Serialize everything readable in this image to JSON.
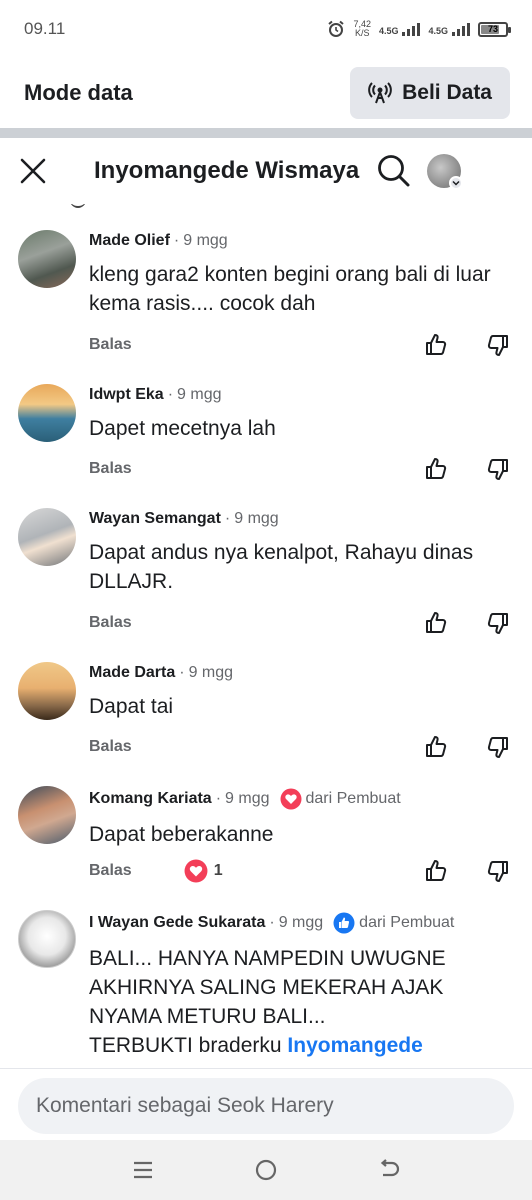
{
  "status_bar": {
    "time": "09.11",
    "net_speed": "7,42",
    "net_unit": "K/S",
    "signal1": "4.5G",
    "signal2": "4.5G",
    "battery": "73",
    "icons": [
      "alarm-icon",
      "signal-icon",
      "battery-icon"
    ]
  },
  "data_bar": {
    "title": "Mode data",
    "buy_label": "Beli Data"
  },
  "header": {
    "title": "Inyomangede Wismaya"
  },
  "comments": [
    {
      "name": "Made Olief",
      "time": "9 mgg",
      "text": "kleng gara2 konten begini orang bali di luar kema rasis.... cocok dah",
      "reply": "Balas"
    },
    {
      "name": "Idwpt Eka",
      "time": "9 mgg",
      "text": "Dapet mecetnya lah",
      "reply": "Balas"
    },
    {
      "name": "Wayan Semangat",
      "time": "9 mgg",
      "text": "Dapat andus nya kenalpot, Rahayu dinas DLLAJR.",
      "reply": "Balas"
    },
    {
      "name": "Made Darta",
      "time": "9 mgg",
      "text": "Dapat tai",
      "reply": "Balas"
    },
    {
      "name": "Komang Kariata",
      "time": "9 mgg",
      "badge": "dari Pembuat",
      "text": "Dapat beberakanne",
      "reply": "Balas",
      "reaction_count": "1"
    },
    {
      "name": "I Wayan Gede Sukarata",
      "time": "9 mgg",
      "badge": "dari Pembuat",
      "text": "BALI... HANYA NAMPEDIN UWUGNE AKHIRNYA SALING MEKERAH AJAK NYAMA METURU BALI...",
      "text_line2": "TERBUKTI braderku",
      "mention": "Inyomangede"
    }
  ],
  "separator": "·",
  "composer": {
    "placeholder": "Komentari sebagai Seok Harery"
  },
  "colors": {
    "accent": "#1877f2",
    "heart": "#f33e58",
    "muted": "#65676b"
  }
}
